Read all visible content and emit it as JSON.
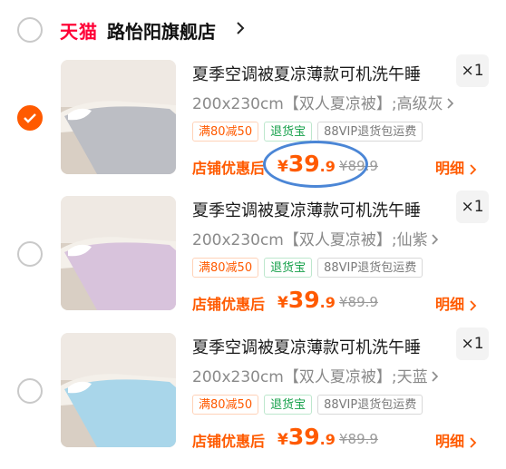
{
  "header": {
    "tmall_logo": "天猫",
    "shop_name": "路怡阳旗舰店",
    "shop_checked": false
  },
  "items": [
    {
      "checked": true,
      "title": "夏季空调被夏凉薄款可机洗午睡",
      "quantity": "×1",
      "spec": "200x230cm【双人夏凉被】;高级灰",
      "tags": [
        "满80减50",
        "退货宝",
        "88VIP退货包运费"
      ],
      "deal_label": "店铺优惠后",
      "price_yen": "¥",
      "price_int": "39",
      "price_dec": ".9",
      "original_price": "¥89.9",
      "detail_label": "明细",
      "thumb_color": "#bcbec4"
    },
    {
      "checked": false,
      "title": "夏季空调被夏凉薄款可机洗午睡",
      "quantity": "×1",
      "spec": "200x230cm【双人夏凉被】;仙紫",
      "tags": [
        "满80减50",
        "退货宝",
        "88VIP退货包运费"
      ],
      "deal_label": "店铺优惠后",
      "price_yen": "¥",
      "price_int": "39",
      "price_dec": ".9",
      "original_price": "¥89.9",
      "detail_label": "明细",
      "thumb_color": "#d8c3dc"
    },
    {
      "checked": false,
      "title": "夏季空调被夏凉薄款可机洗午睡",
      "quantity": "×1",
      "spec": "200x230cm【双人夏凉被】;天蓝",
      "tags": [
        "满80减50",
        "退货宝",
        "88VIP退货包运费"
      ],
      "deal_label": "店铺优惠后",
      "price_yen": "¥",
      "price_int": "39",
      "price_dec": ".9",
      "original_price": "¥89.9",
      "detail_label": "明细",
      "thumb_color": "#a9d6ea"
    }
  ],
  "colors": {
    "accent": "#ff5a00",
    "tmall_red": "#ff0036",
    "return_green": "#15a04a",
    "annotation_blue": "#4b86d6"
  },
  "icons": {
    "shop_arrow": "chevron-right-icon",
    "spec_arrow": "chevron-right-icon",
    "detail_arrow": "chevron-right-icon",
    "check": "check-icon"
  }
}
